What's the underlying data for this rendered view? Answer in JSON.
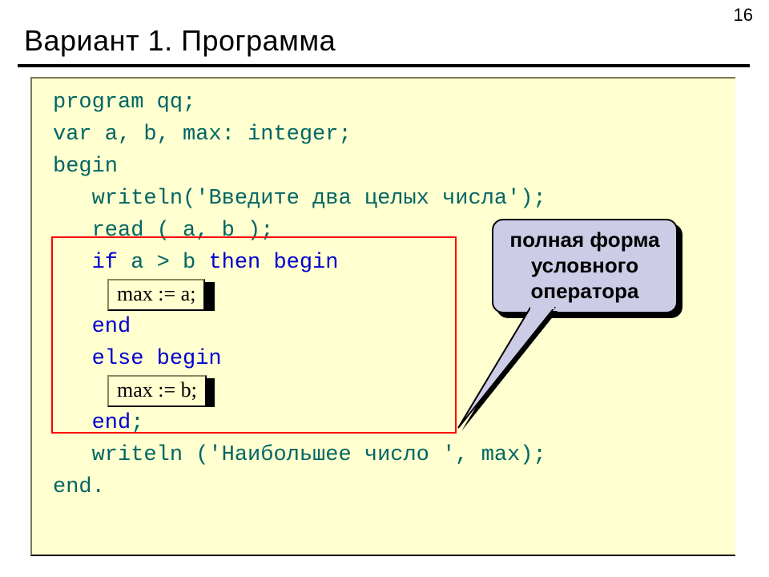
{
  "page_number": "16",
  "title": "Вариант 1. Программа",
  "code": {
    "l1": "program qq;",
    "l2": "var a, b, max: integer;",
    "l3": "begin",
    "l4a": "   writeln('",
    "l4b": "Введите два целых числа",
    "l4c": "');",
    "l5": "   read ( a, b );",
    "l6a": "   ",
    "l6b": "if",
    "l6c": " a > b ",
    "l6d": "then begin",
    "l7": "",
    "l8a": "   ",
    "l8b": "end",
    "l9a": "   ",
    "l9b": "else begin",
    "l10": "",
    "l11a": "   ",
    "l11b": "end",
    "l11c": ";",
    "l12a": "   writeln ('",
    "l12b": "Наибольшее число ",
    "l12c": "', max);",
    "l13": "end."
  },
  "inline1": "max := a;",
  "inline2": "max := b;",
  "callout": {
    "line1": "полная форма",
    "line2": "условного",
    "line3": "оператора"
  }
}
